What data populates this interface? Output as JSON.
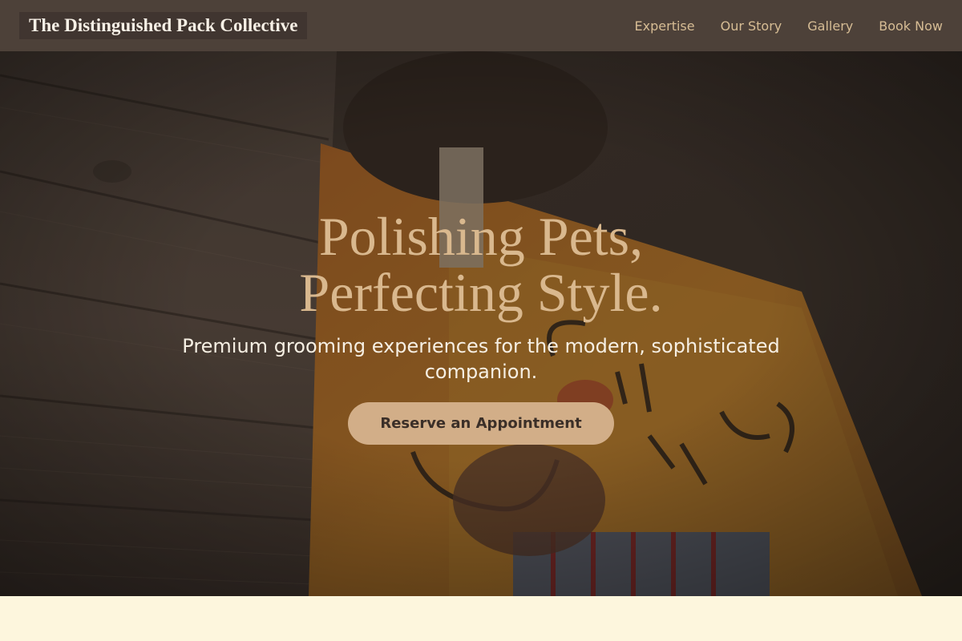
{
  "header": {
    "brand": "The Distinguished Pack Collective",
    "nav": [
      "Expertise",
      "Our Story",
      "Gallery",
      "Book Now"
    ]
  },
  "hero": {
    "title_line1": "Polishing Pets,",
    "title_line2": "Perfecting Style.",
    "subtitle": "Premium grooming experiences for the modern, sophisticated companion.",
    "cta_label": "Reserve an Appointment"
  },
  "colors": {
    "nav_bg": "#4d4139",
    "accent": "#d2ae88",
    "page_bg": "#fdf6dd"
  }
}
